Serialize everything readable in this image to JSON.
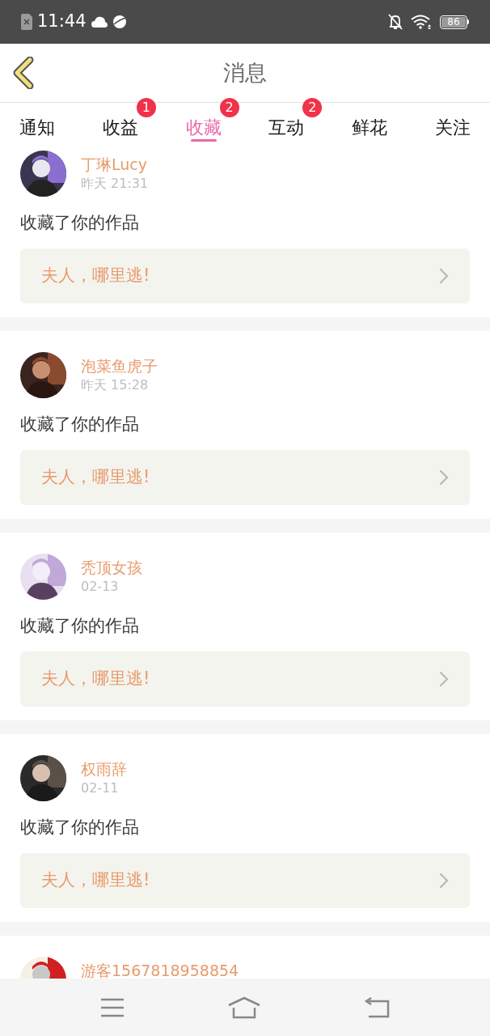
{
  "status_bar": {
    "time": "11:44",
    "battery": "86"
  },
  "header": {
    "title": "消息"
  },
  "tabs": [
    {
      "label": "通知",
      "selected": false
    },
    {
      "label": "收益",
      "selected": false,
      "badge": "1"
    },
    {
      "label": "收藏",
      "selected": true,
      "badge": "2"
    },
    {
      "label": "互动",
      "selected": false,
      "badge": "2"
    },
    {
      "label": "鲜花",
      "selected": false
    },
    {
      "label": "关注",
      "selected": false
    }
  ],
  "messages": [
    {
      "user": "丁琳Lucy",
      "time": "昨天 21:31",
      "action": "收藏了你的作品",
      "work": "夫人，哪里逃!"
    },
    {
      "user": "泡菜鱼虎子",
      "time": "昨天 15:28",
      "action": "收藏了你的作品",
      "work": "夫人，哪里逃!"
    },
    {
      "user": "秃顶女孩",
      "time": "02-13",
      "action": "收藏了你的作品",
      "work": "夫人，哪里逃!"
    },
    {
      "user": "权雨辞",
      "time": "02-11",
      "action": "收藏了你的作品",
      "work": "夫人，哪里逃!"
    },
    {
      "user": "游客1567818958854"
    }
  ]
}
